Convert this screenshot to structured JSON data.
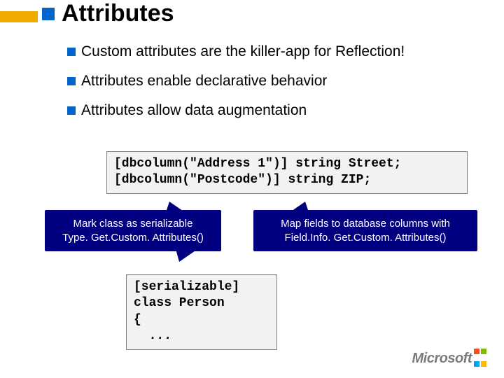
{
  "title": "Attributes",
  "bullets": [
    "Custom attributes are the killer-app for Reflection!",
    "Attributes enable declarative behavior",
    "Attributes allow data augmentation"
  ],
  "code_box_1": "[dbcolumn(\"Address 1\")] string Street;\n[dbcolumn(\"Postcode\")] string ZIP;",
  "callout_left": {
    "line1": "Mark class as serializable",
    "line2": "Type. Get.Custom. Attributes()"
  },
  "callout_right": {
    "line1": "Map fields to database columns with",
    "line2": "Field.Info. Get.Custom. Attributes()"
  },
  "code_box_2": "[serializable]\nclass Person\n{\n  ...",
  "footer_logo": "Microsoft"
}
